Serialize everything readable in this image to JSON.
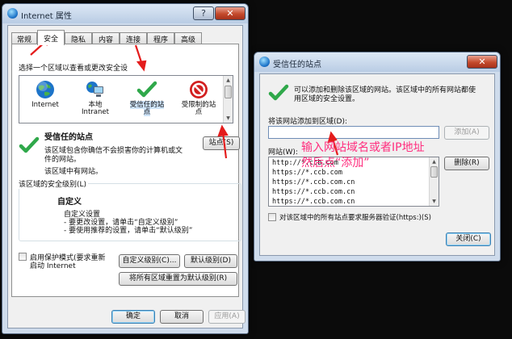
{
  "internet_options": {
    "title": "Internet 属性",
    "help_glyph": "?",
    "close_glyph": "✕",
    "tabs": [
      {
        "label": "常规"
      },
      {
        "label": "安全"
      },
      {
        "label": "隐私"
      },
      {
        "label": "内容"
      },
      {
        "label": "连接"
      },
      {
        "label": "程序"
      },
      {
        "label": "高级"
      }
    ],
    "active_tab": "安全",
    "zone_prompt": "选择一个区域以查看或更改安全设",
    "zones": [
      {
        "line1": "Internet",
        "line2": ""
      },
      {
        "line1": "本地",
        "line2": "Intranet"
      },
      {
        "line1": "受信任的站",
        "line2": "点"
      },
      {
        "line1": "受限制的站",
        "line2": "点"
      }
    ],
    "selected_zone_title": "受信任的站点",
    "selected_zone_desc_1": "该区域包含你确信不会损害你的计算机或文",
    "selected_zone_desc_2": "件的网站。",
    "selected_zone_desc_3": "该区域中有网站。",
    "sites_button": "站点(S)",
    "security_level_label": "该区域的安全级别(L)",
    "custom_title": "自定义",
    "custom_line_1": "自定义设置",
    "custom_line_2": "- 要更改设置，请单击“自定义级别”",
    "custom_line_3": "- 要使用推荐的设置，请单击“默认级别”",
    "protected_mode_1": "启用保护模式(要求重新",
    "protected_mode_2": "启动 Internet",
    "custom_level_button": "自定义级别(C)...",
    "default_level_button": "默认级别(D)",
    "reset_all_button": "将所有区域重置为默认级别(R)",
    "ok_button": "确定",
    "cancel_button": "取消",
    "apply_button": "应用(A)"
  },
  "trusted_sites": {
    "title": "受信任的站点",
    "close_glyph": "✕",
    "intro_1": "可以添加和删除该区域的网站。该区域中的所有网站都使",
    "intro_2": "用区域的安全设置。",
    "add_label": "将该网站添加到区域(D):",
    "add_input_value": "",
    "add_button": "添加(A)",
    "sites_label": "网站(W):",
    "sites": [
      "http://*.ccb.com",
      "https://*.ccb.com",
      "https://*.ccb.com.cn",
      "https://*.ccb.com.cn",
      "https://*.ccb.com.cn"
    ],
    "remove_button": "删除(R)",
    "require_https": "对该区域中的所有站点要求服务器验证(https:)(S)",
    "close_button": "关闭(C)"
  },
  "annotations": {
    "line_1": "输入网站域名或者IP地址",
    "line_2": "然后点“添加”"
  },
  "colors": {
    "annotation": "#ff2e7e",
    "check_green": "#2fa84a",
    "stop_red": "#d21f1f",
    "globe_blue": "#1d74c9"
  }
}
